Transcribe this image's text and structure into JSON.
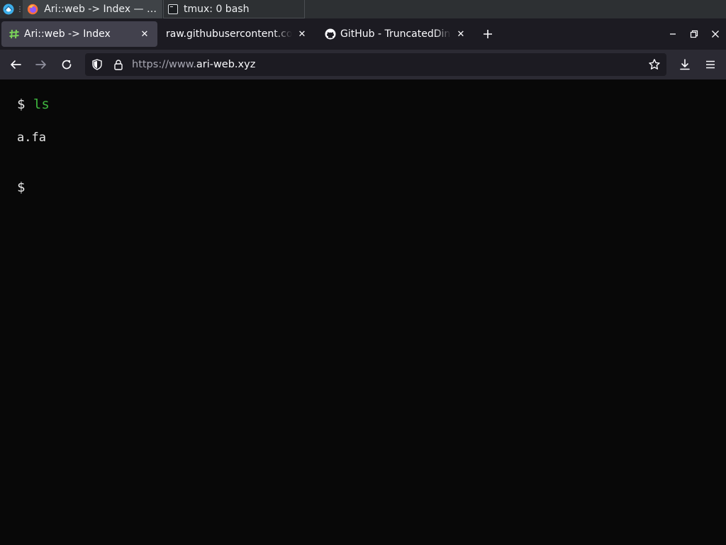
{
  "taskbar": {
    "tasks": [
      {
        "label": "Ari::web -> Index — Mo..."
      },
      {
        "label": "tmux: 0 bash"
      }
    ]
  },
  "browser": {
    "tabs": [
      {
        "title": "Ari::web -> Index",
        "active": true
      },
      {
        "title": "raw.githubusercontent.com/"
      },
      {
        "title": "GitHub - TruncatedDinosour"
      }
    ],
    "url": {
      "scheme": "https://www.",
      "host": "ari-web.xyz"
    }
  },
  "terminal": {
    "prompt": "$",
    "command": "ls",
    "output": "a.fa",
    "prompt2": "$"
  },
  "colors": {
    "command": "#3fb63f",
    "page_bg": "#080808",
    "tab_active_bg": "#42414d"
  }
}
